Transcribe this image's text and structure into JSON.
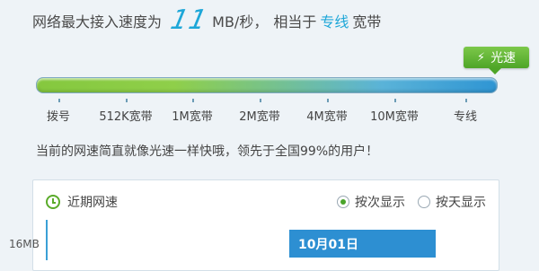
{
  "headline": {
    "prefix": "网络最大接入速度为",
    "speed_value": "11",
    "speed_unit": "MB/秒，",
    "equals_text": "相当于",
    "equals_value": "专线",
    "suffix": "宽带"
  },
  "badge": {
    "label": "光速",
    "icon": "lightning-icon"
  },
  "speed_scale": {
    "labels": [
      "拨号",
      "512K宽带",
      "1M宽带",
      "2M宽带",
      "4M宽带",
      "10M宽带",
      "专线"
    ]
  },
  "note": "当前的网速简直就像光速一样快哦，领先于全国99%的用户！",
  "history_panel": {
    "title": "近期网速",
    "icon": "clock-icon",
    "options": [
      {
        "label": "按次显示",
        "selected": true
      },
      {
        "label": "按天显示",
        "selected": false
      }
    ],
    "y_label": "16MB",
    "tooltip_date": "10月01日"
  },
  "colors": {
    "accent": "#1ea7d8",
    "badge_green": "#4ea527",
    "tooltip_blue": "#2d8fd2"
  }
}
